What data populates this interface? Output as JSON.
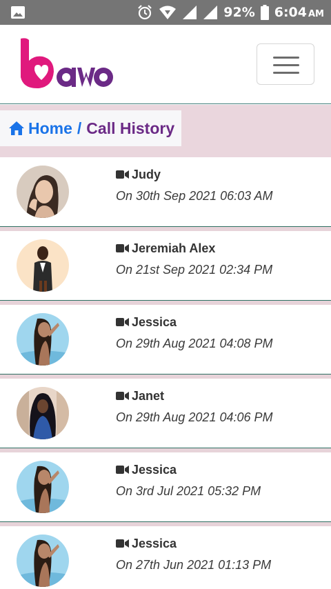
{
  "statusbar": {
    "battery": "92%",
    "time": "6:04",
    "ampm": "AM"
  },
  "header": {
    "brand": "bawo"
  },
  "breadcrumb": {
    "home": "Home",
    "separator": "/",
    "current": "Call History"
  },
  "calls": [
    {
      "name": "Judy",
      "date": "On 30th Sep 2021 06:03 AM"
    },
    {
      "name": "Jeremiah Alex",
      "date": "On 21st Sep 2021 02:34 PM"
    },
    {
      "name": "Jessica",
      "date": "On 29th Aug 2021 04:08 PM"
    },
    {
      "name": "Janet",
      "date": "On 29th Aug 2021 04:06 PM"
    },
    {
      "name": "Jessica",
      "date": "On 3rd Jul 2021 05:32 PM"
    },
    {
      "name": "Jessica",
      "date": "On 27th Jun 2021 01:13 PM"
    }
  ]
}
